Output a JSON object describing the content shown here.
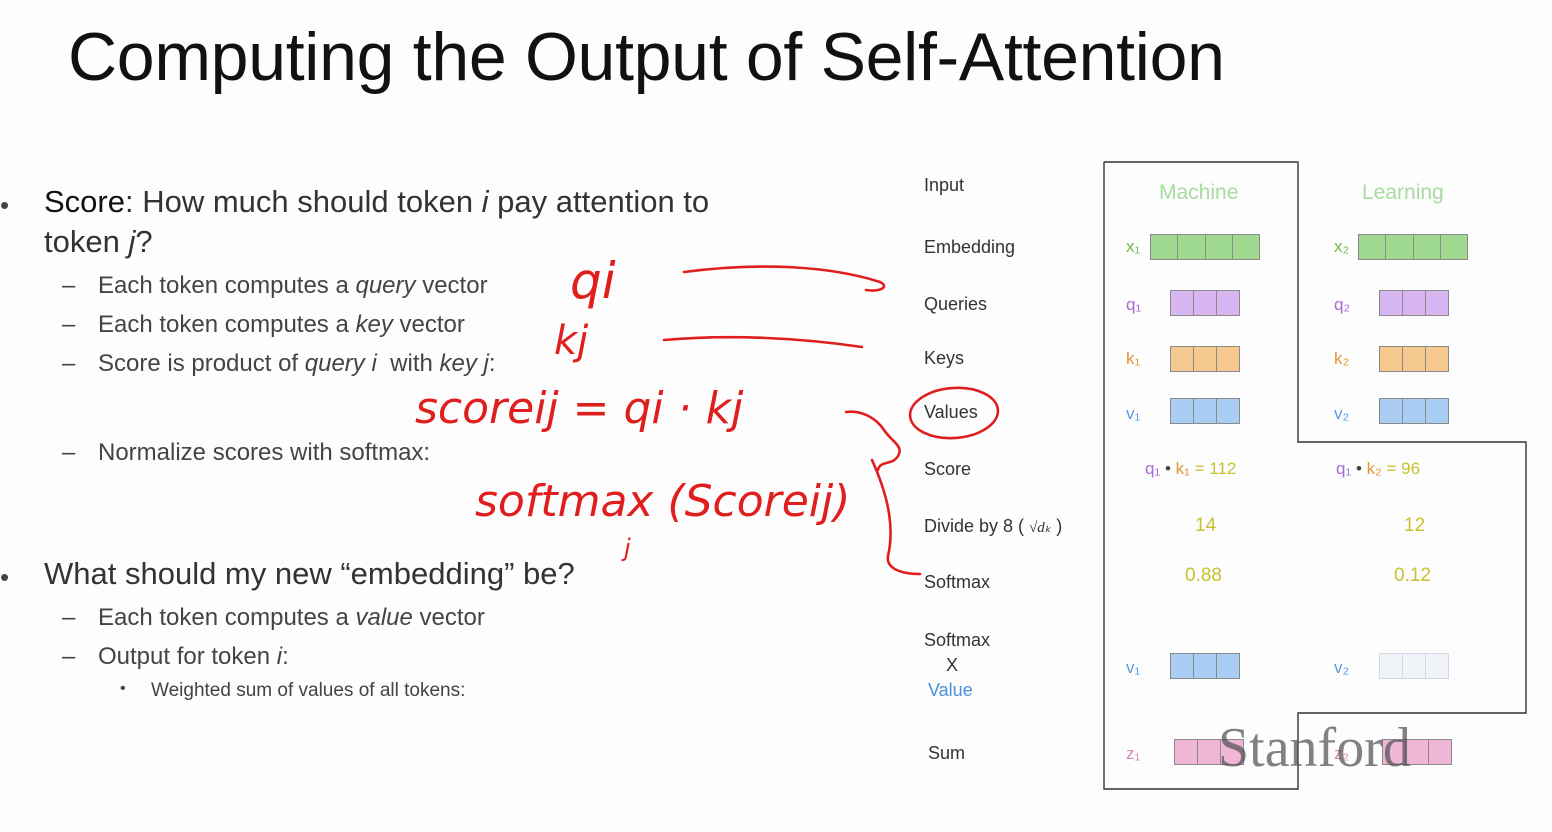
{
  "slide": {
    "title": "Computing the Output of Self-Attention",
    "bullet_score": {
      "label": "Score",
      "text_a": ": How much should token ",
      "i": "i",
      "text_b": " pay attention to",
      "text_c": "token ",
      "j": "j",
      "text_d": "?",
      "sub1": {
        "a": "Each token computes a ",
        "em": "query",
        "b": " vector"
      },
      "sub2": {
        "a": "Each token computes a ",
        "em": "key",
        "b": " vector"
      },
      "sub3": {
        "a": "Score is product of ",
        "em1": "query i",
        "mid": "  with ",
        "em2": "key j",
        "end": ":"
      },
      "sub4": "Normalize scores with softmax:"
    },
    "bullet_embed": {
      "text": "What should my new “embedding” be?",
      "sub1": {
        "a": "Each token computes a ",
        "em": "value",
        "b": " vector"
      },
      "sub2": {
        "a": "Output for token ",
        "em": "i",
        "b": ":"
      },
      "subsub": "Weighted sum of values of all tokens:"
    },
    "bullet_symbol": "•",
    "dash_symbol": "–"
  },
  "handwriting": {
    "qi": "qi",
    "kj": "kj",
    "score_eq": "scoreij = qi · kj",
    "softmax": "softmax (Scoreij)",
    "sub_j": "j"
  },
  "diagram": {
    "row_labels": {
      "input": "Input",
      "embedding": "Embedding",
      "queries": "Queries",
      "keys": "Keys",
      "values": "Values",
      "score": "Score",
      "divide": "Divide by 8 (",
      "divide_close": ")",
      "sqrt_label": "√dₖ",
      "softmax": "Softmax",
      "softmax2": "Softmax",
      "times": "X",
      "value": "Value",
      "sum": "Sum"
    },
    "tokens": [
      {
        "word": "Machine",
        "x": "x₁",
        "q": "q₁",
        "k": "k₁",
        "v": "v₁",
        "v2": "v₁",
        "z": "z₁",
        "score_q": "q₁",
        "score_dot": "•",
        "score_k": "k₁",
        "score_eq": "=",
        "score_val": "112",
        "divided": "14",
        "softmax": "0.88"
      },
      {
        "word": "Learning",
        "x": "x₂",
        "q": "q₂",
        "k": "k₂",
        "v": "v₂",
        "v2": "v₂",
        "z": "z₂",
        "score_q": "q₁",
        "score_dot": "•",
        "score_k": "k₂",
        "score_eq": "=",
        "score_val": "96",
        "divided": "12",
        "softmax": "0.12"
      }
    ],
    "colors": {
      "embedding": "#9fd88f",
      "query": "#d7b6f2",
      "key": "#f5c98d",
      "value": "#a9cdf3",
      "output": "#efb6d6",
      "numbers": "#c9c12d",
      "ink": "#e01e1e"
    }
  },
  "watermark": "Stanford"
}
